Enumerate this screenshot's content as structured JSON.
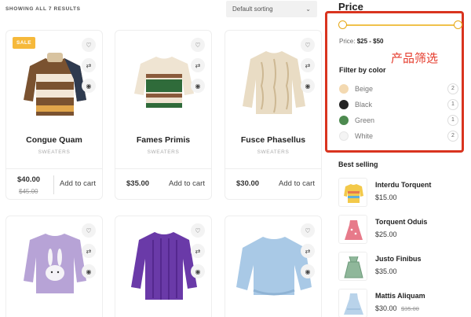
{
  "toolbar": {
    "results_text": "SHOWING ALL 7 RESULTS",
    "sort_value": "Default sorting"
  },
  "products": [
    {
      "title": "Congue Quam",
      "category": "SWEATERS",
      "price": "$40.00",
      "old_price": "$45.00",
      "badge": "SALE",
      "add_to_cart": "Add to cart"
    },
    {
      "title": "Fames Primis",
      "category": "SWEATERS",
      "price": "$35.00",
      "add_to_cart": "Add to cart"
    },
    {
      "title": "Fusce Phasellus",
      "category": "SWEATERS",
      "price": "$30.00",
      "add_to_cart": "Add to cart"
    },
    {
      "title": "",
      "category": ""
    },
    {
      "title": "",
      "category": ""
    },
    {
      "title": "",
      "category": ""
    }
  ],
  "sidebar": {
    "price_title": "Price",
    "price_label": "Price:",
    "price_range": "$25 - $50",
    "annotation": "产品筛选",
    "filter_title": "Filter by color",
    "colors": [
      {
        "name": "Beige",
        "count": "2",
        "hex": "#f3d9b1"
      },
      {
        "name": "Black",
        "count": "1",
        "hex": "#222222"
      },
      {
        "name": "Green",
        "count": "1",
        "hex": "#4d8a4f"
      },
      {
        "name": "White",
        "count": "2",
        "hex": "#f4f4f4"
      }
    ],
    "best_selling_title": "Best selling",
    "best_selling": [
      {
        "name": "Interdu Torquent",
        "price": "$15.00"
      },
      {
        "name": "Torquent Oduis",
        "price": "$25.00"
      },
      {
        "name": "Justo Finibus",
        "price": "$35.00"
      },
      {
        "name": "Mattis Aliquam",
        "price": "$30.00",
        "old_price": "$35.00"
      }
    ]
  },
  "icons": [
    "heart-icon",
    "shuffle-icon",
    "eye-icon",
    "chevron-down-icon"
  ],
  "colors": {
    "accent": "#f0c14b",
    "highlight_border": "#d9341f",
    "annotation_text": "#e53b2c",
    "sale_badge": "#f6b93b"
  }
}
